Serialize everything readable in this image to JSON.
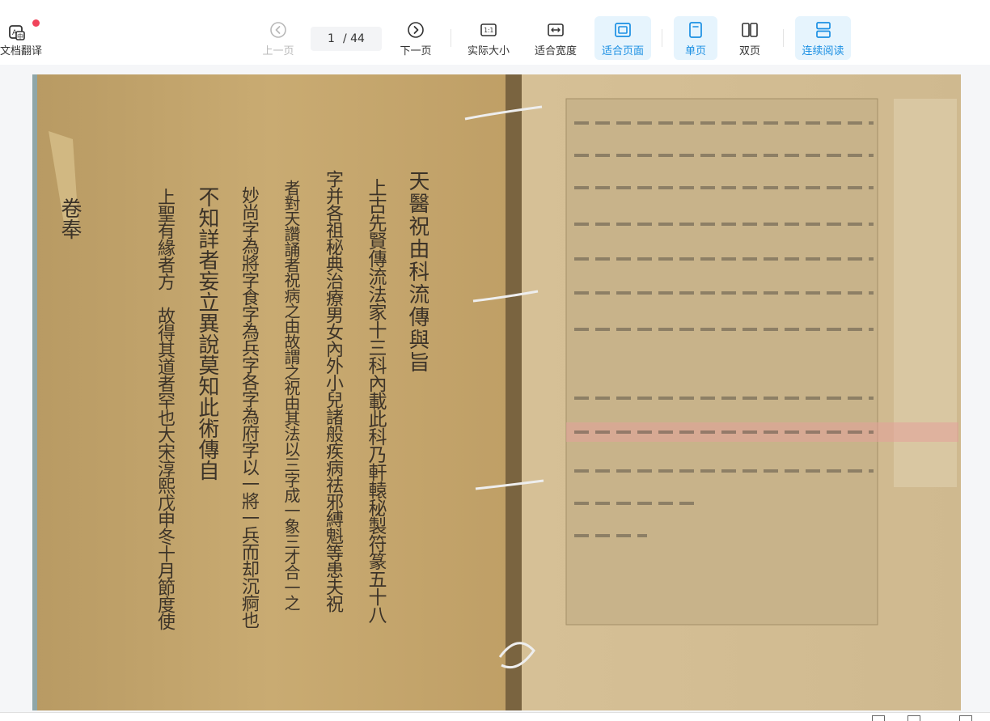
{
  "toolbar": {
    "translate_label": "文档翻译",
    "prev_label": "上一页",
    "current_page": "1",
    "total_pages": "/ 44",
    "next_label": "下一页",
    "actual_size_label": "实际大小",
    "actual_size_icon_text": "1:1",
    "fit_width_label": "适合宽度",
    "fit_page_label": "适合页面",
    "single_page_label": "单页",
    "double_page_label": "双页",
    "continuous_label": "连续阅读"
  },
  "document": {
    "columns": [
      "天醫祝由科流傳與旨",
      "上古先賢傳流法家十三科內載此科乃軒轅秘製符篆五十八",
      "字并各祖秘典治療男女內外小兒諸般疾病祛邪縛魁等患夫祝",
      "者對天讚誦者祝病之由故謂之祝由其法以三字成一象三才合一之",
      "妙尚字為將字食字為兵字各字為府字以一將一兵而却沉痾也",
      "不知詳者妄立異說莫知此術傳自",
      "上聖有緣者方　故得其道者罕也大宋淳熙戊申冬十月節度使"
    ],
    "side_label": "卷奉"
  },
  "colors": {
    "accent": "#1a8fe3",
    "active_bg": "#e6f4fd",
    "viewer_bg": "#f5f6f8",
    "badge": "#f0445b"
  },
  "icons": [
    "translate-icon",
    "prev-page-icon",
    "next-page-icon",
    "actual-size-icon",
    "fit-width-icon",
    "fit-page-icon",
    "single-page-icon",
    "double-page-icon",
    "continuous-read-icon"
  ]
}
